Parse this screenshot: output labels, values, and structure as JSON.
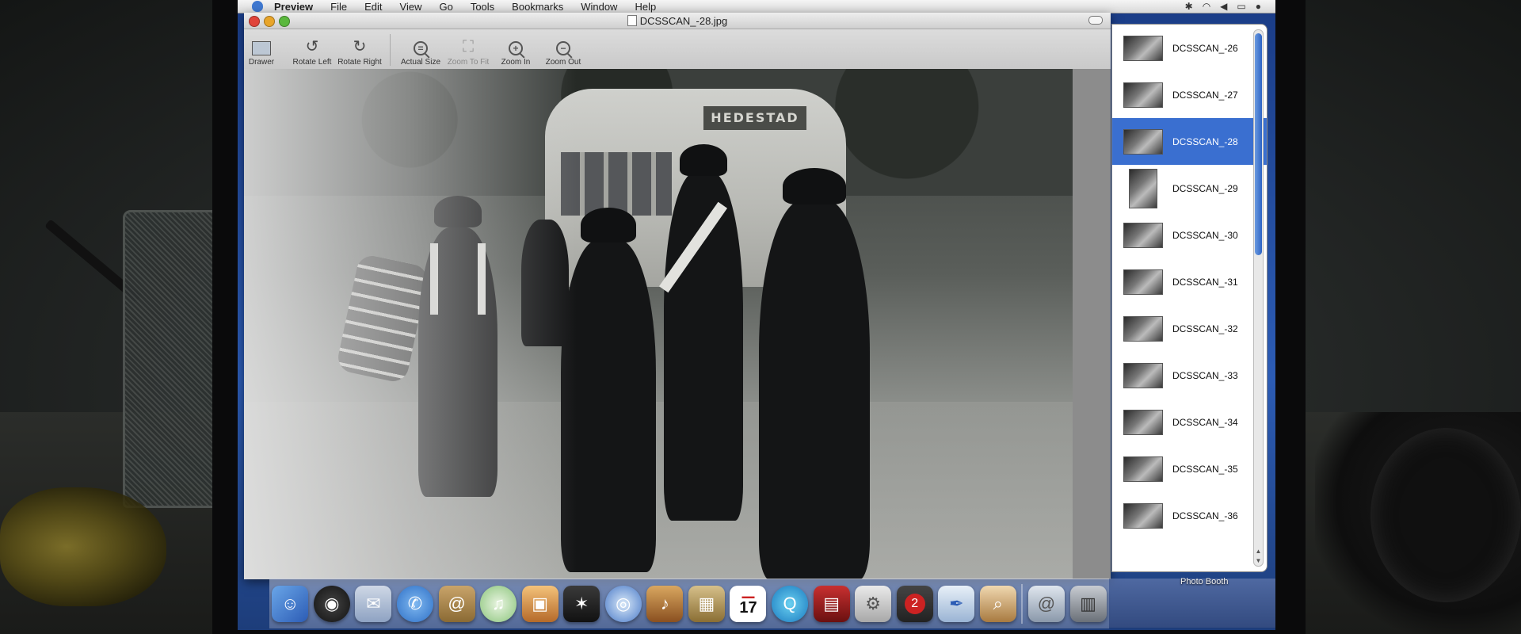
{
  "menubar": {
    "app_name": "Preview",
    "items": [
      "File",
      "Edit",
      "View",
      "Go",
      "Tools",
      "Bookmarks",
      "Window",
      "Help"
    ]
  },
  "window": {
    "title": "DCSSCAN_-28.jpg"
  },
  "toolbar": {
    "drawer_label": "Drawer",
    "rotate_left_label": "Rotate Left",
    "rotate_right_label": "Rotate Right",
    "actual_size_label": "Actual Size",
    "zoom_to_fit_label": "Zoom To Fit",
    "zoom_in_label": "Zoom In",
    "zoom_out_label": "Zoom Out"
  },
  "photo": {
    "sign_text": "HEDESTAD"
  },
  "drawer": {
    "items": [
      {
        "label": "DCSSCAN_-26"
      },
      {
        "label": "DCSSCAN_-27"
      },
      {
        "label": "DCSSCAN_-28",
        "selected": true
      },
      {
        "label": "DCSSCAN_-29"
      },
      {
        "label": "DCSSCAN_-30"
      },
      {
        "label": "DCSSCAN_-31"
      },
      {
        "label": "DCSSCAN_-32"
      },
      {
        "label": "DCSSCAN_-33"
      },
      {
        "label": "DCSSCAN_-34"
      },
      {
        "label": "DCSSCAN_-35"
      },
      {
        "label": "DCSSCAN_-36"
      }
    ]
  },
  "dock": {
    "hover_label": "Photo Booth",
    "calendar_day": "17",
    "badge_number": "2"
  },
  "colors": {
    "selection": "#3a6fd0",
    "desktop": "#2c5cb5"
  }
}
